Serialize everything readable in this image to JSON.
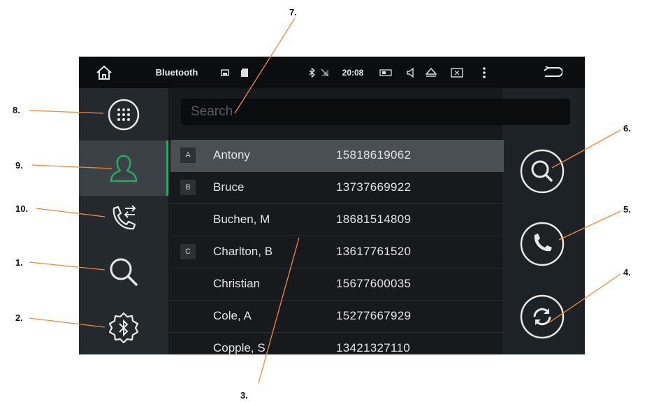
{
  "statusbar": {
    "title": "Bluetooth",
    "time": "20:08",
    "icons": [
      "home-icon",
      "image-icon",
      "sd-card-icon",
      "bluetooth-icon",
      "no-signal-icon",
      "battery-icon",
      "volume-icon",
      "eject-icon",
      "screen-icon",
      "more-vertical-icon",
      "back-icon"
    ]
  },
  "search": {
    "placeholder": "Search"
  },
  "sidebar": {
    "items": [
      {
        "icon": "dialpad-icon"
      },
      {
        "icon": "contacts-icon",
        "active": true
      },
      {
        "icon": "call-history-icon"
      },
      {
        "icon": "search-icon"
      },
      {
        "icon": "bluetooth-settings-icon"
      }
    ]
  },
  "contacts": [
    {
      "letter": "A",
      "name": "Antony",
      "phone": "15818619062"
    },
    {
      "letter": "B",
      "name": "Bruce",
      "phone": "13737669922"
    },
    {
      "letter": "",
      "name": "Buchen, M",
      "phone": "18681514809"
    },
    {
      "letter": "C",
      "name": "Charlton, B",
      "phone": "13617761520"
    },
    {
      "letter": "",
      "name": "Christian",
      "phone": "15677600035"
    },
    {
      "letter": "",
      "name": "Cole, A",
      "phone": "15277667929"
    },
    {
      "letter": "",
      "name": "Copple, S",
      "phone": "13421327110"
    }
  ],
  "actions": [
    "search-contact-icon",
    "call-icon",
    "sync-icon"
  ],
  "callouts": {
    "c1": "1.",
    "c2": "2.",
    "c3": "3.",
    "c4": "4.",
    "c5": "5.",
    "c6": "6.",
    "c7": "7.",
    "c8": "8.",
    "c9": "9.",
    "c10": "10."
  },
  "colors": {
    "accent": "#28a864",
    "callout_line": "#f08a3a",
    "background": "#1d2226"
  }
}
